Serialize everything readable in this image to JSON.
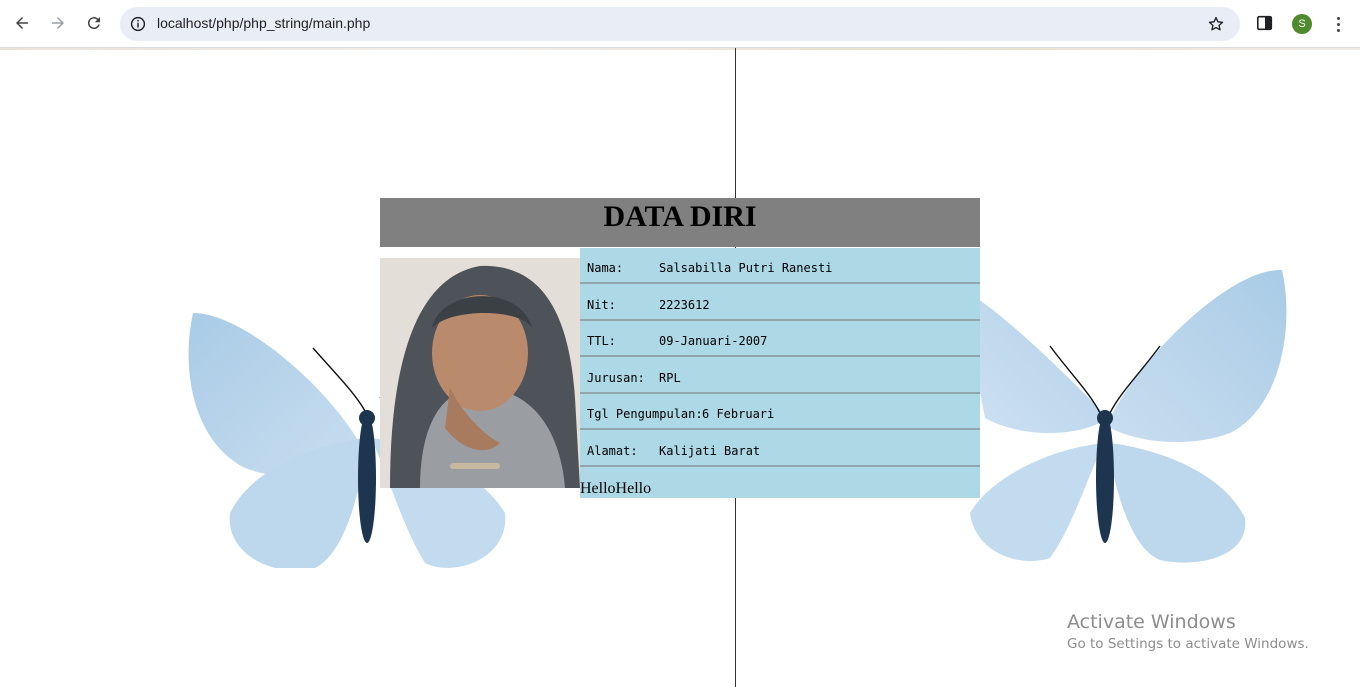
{
  "browser": {
    "url": "localhost/php/php_string/main.php",
    "profile_initial": "S"
  },
  "page": {
    "title": "DATA DIRI",
    "fields": [
      {
        "label": "Nama:",
        "value": "Salsabilla Putri Ranesti"
      },
      {
        "label": "Nit:",
        "value": "2223612"
      },
      {
        "label": "TTL:",
        "value": "09-Januari-2007"
      },
      {
        "label": "Jurusan:",
        "value": "RPL"
      },
      {
        "label": "Tgl Pengumpulan:",
        "value": "6 Februari"
      },
      {
        "label": "Alamat:",
        "value": "Kalijati Barat"
      }
    ],
    "footer_text": "HelloHello",
    "colors": {
      "header_bg": "#808080",
      "table_bg": "#add8e6"
    }
  },
  "os_overlay": {
    "line1": "Activate Windows",
    "line2": "Go to Settings to activate Windows."
  }
}
